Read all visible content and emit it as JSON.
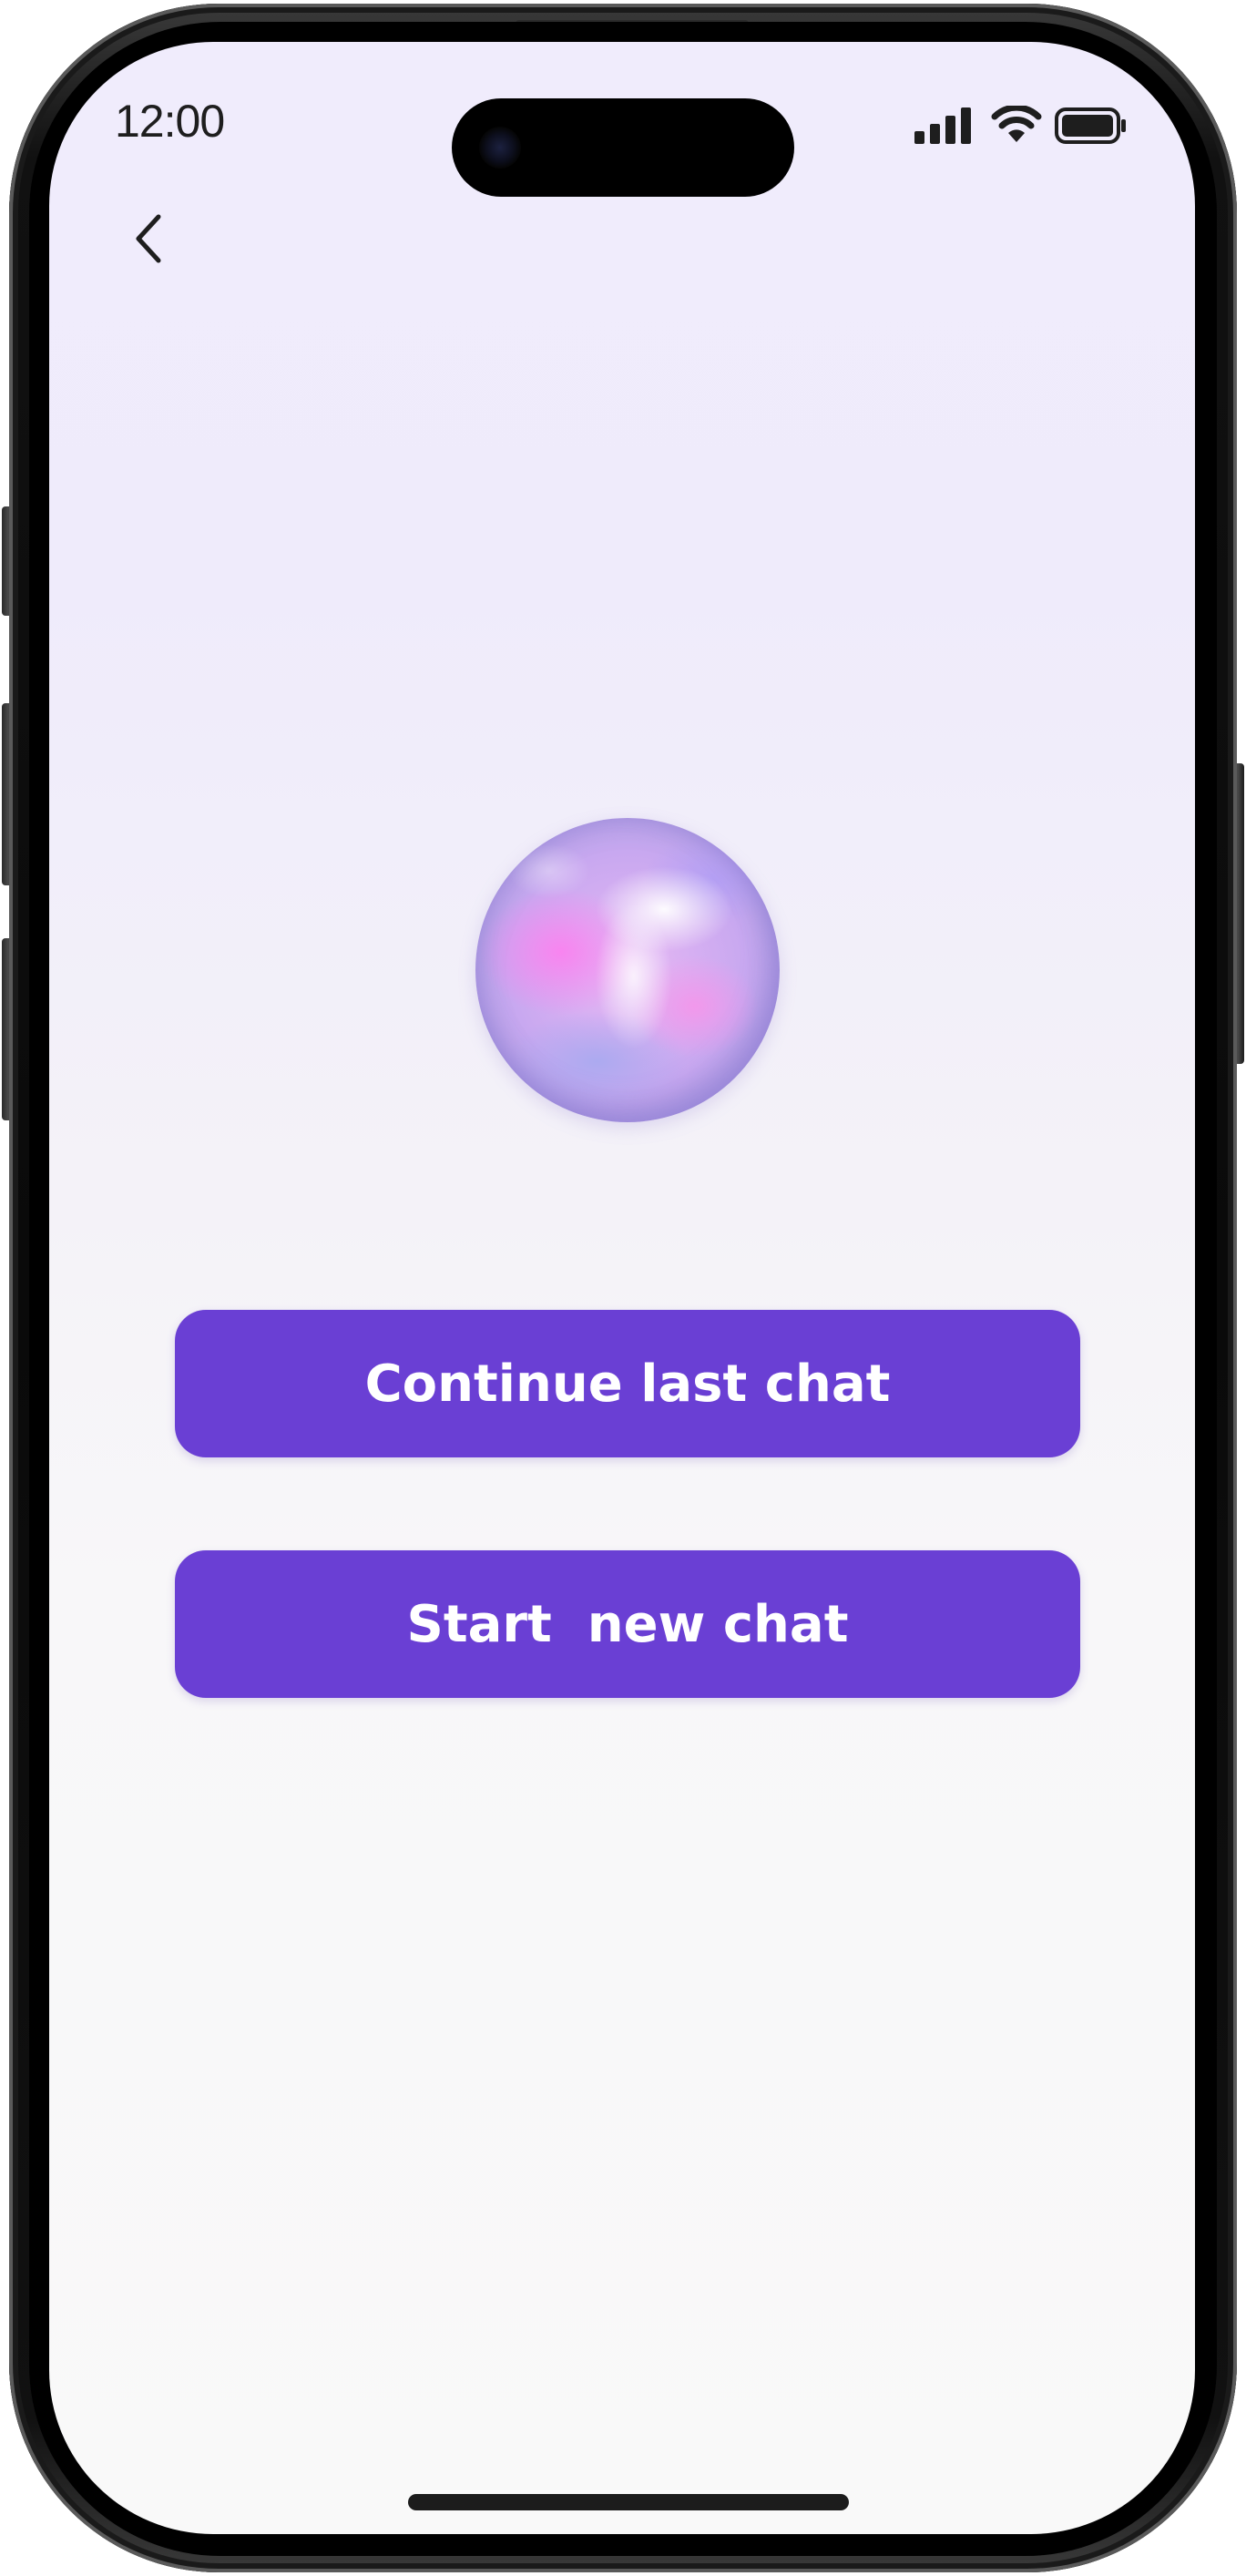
{
  "status_bar": {
    "time": "12:00",
    "icons": [
      "signal-icon",
      "wifi-icon",
      "battery-icon"
    ]
  },
  "nav": {
    "back_icon": "chevron-left-icon"
  },
  "assistant": {
    "orb_icon": "assistant-orb"
  },
  "actions": {
    "continue_label": "Continue last chat",
    "new_label": "Start  new chat"
  },
  "colors": {
    "accent": "#6a3fd4",
    "button_text": "#ffffff",
    "background_top": "#f0ecfc",
    "background_bottom": "#f9f9f9"
  }
}
